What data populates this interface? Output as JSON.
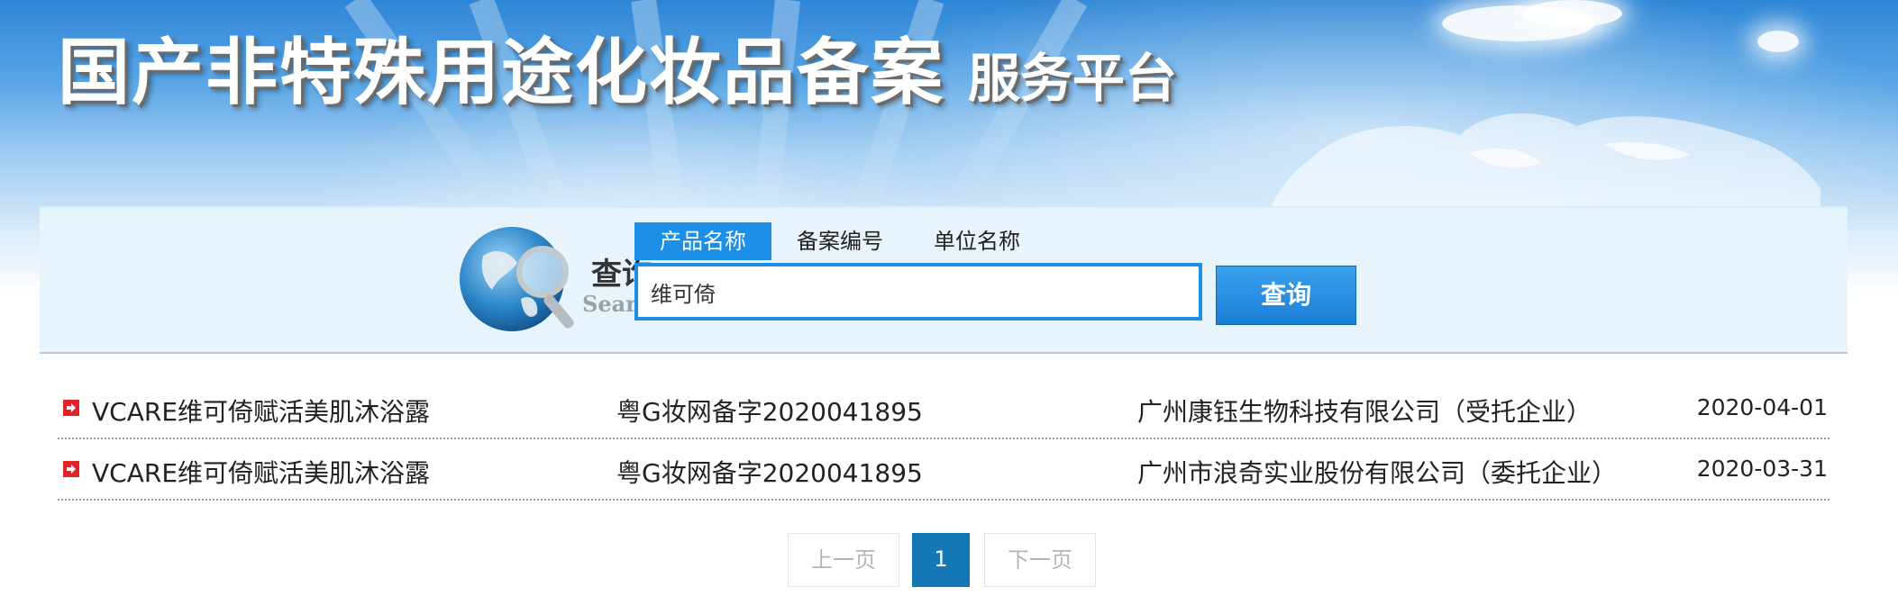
{
  "banner": {
    "title": "国产非特殊用途化妆品备案",
    "subtitle": "服务平台"
  },
  "search": {
    "label_zh": "查询",
    "label_en": "Search",
    "tabs": [
      {
        "label": "产品名称",
        "active": true
      },
      {
        "label": "备案编号",
        "active": false
      },
      {
        "label": "单位名称",
        "active": false
      }
    ],
    "query_value": "维可倚",
    "button_label": "查询"
  },
  "results": [
    {
      "product": "VCARE维可倚赋活美肌沐浴露",
      "reg_no": "粤G妆网备字2020041895",
      "company": "广州康钰生物科技有限公司（受托企业）",
      "date": "2020-04-01"
    },
    {
      "product": "VCARE维可倚赋活美肌沐浴露",
      "reg_no": "粤G妆网备字2020041895",
      "company": "广州市浪奇实业股份有限公司（委托企业）",
      "date": "2020-03-31"
    }
  ],
  "pagination": {
    "prev": "上一页",
    "current": "1",
    "next": "下一页"
  },
  "colors": {
    "accent": "#1d8fe6",
    "page_current": "#1677b5",
    "icon_red": "#e0242a"
  }
}
